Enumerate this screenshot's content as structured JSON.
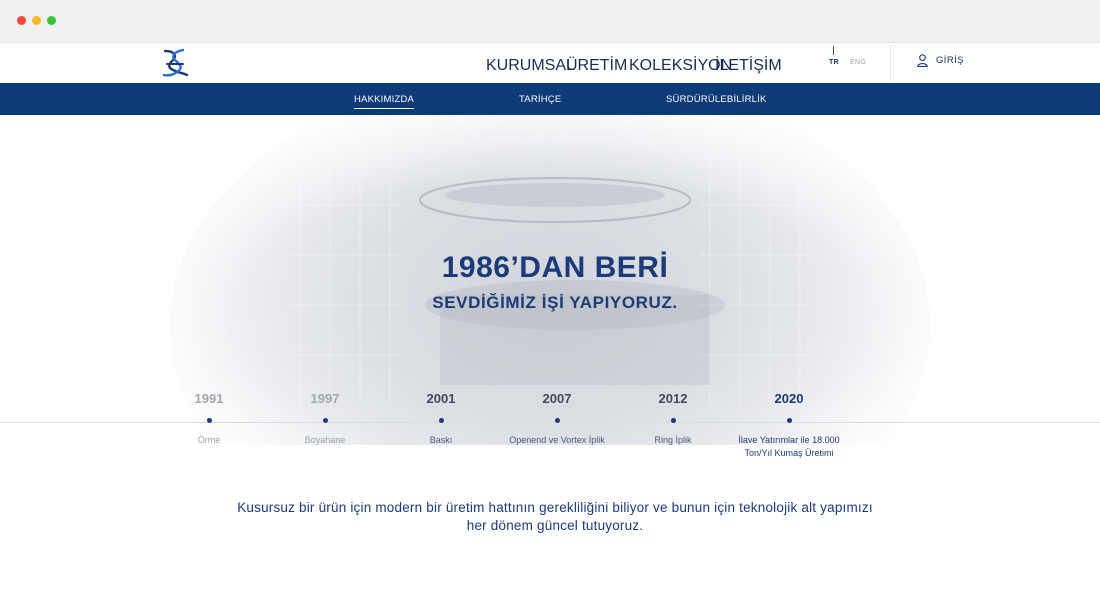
{
  "window": {
    "controls": [
      "close",
      "minimize",
      "maximize"
    ]
  },
  "header": {
    "logo_icon": "brand-logo",
    "nav": [
      {
        "label": "KURUMSAL",
        "active": true
      },
      {
        "label": "ÜRETİM",
        "active": false
      },
      {
        "label": "KOLEKSİYON",
        "active": false
      },
      {
        "label": "İLETİŞİM",
        "active": false
      }
    ],
    "lang": {
      "tr": "TR",
      "eng": "ENG",
      "selected": "TR"
    },
    "login_label": "GİRİŞ",
    "login_icon": "user-icon"
  },
  "subnav": {
    "items": [
      {
        "label": "HAKKIMIZDA",
        "active": true
      },
      {
        "label": "TARİHÇE",
        "active": false
      },
      {
        "label": "SÜRDÜRÜLEBİLİRLİK",
        "active": false
      }
    ]
  },
  "hero": {
    "title": "1986’DAN BERİ",
    "subtitle": "SEVDİĞİMİZ İŞİ YAPIYORUZ.",
    "timeline": [
      {
        "year": "1991",
        "label": "Örme"
      },
      {
        "year": "1997",
        "label": "Boyahane"
      },
      {
        "year": "2001",
        "label": "Baskı"
      },
      {
        "year": "2007",
        "label": "Openend ve Vortex İplik"
      },
      {
        "year": "2012",
        "label": "Ring İplik"
      },
      {
        "year": "2020",
        "label": "İlave Yatırımlar ile 18.000 Ton/Yıl Kumaş Üretimi",
        "active": true
      }
    ],
    "description": "Kusursuz bir ürün için modern bir üretim hattının gerekliliğini biliyor ve bunun için teknolojik alt yapımızı her dönem güncel tutuyoruz."
  },
  "colors": {
    "brand_navy": "#0f3a78",
    "text_navy": "#1b3a7a",
    "accent_blue": "#1f5bb5"
  }
}
